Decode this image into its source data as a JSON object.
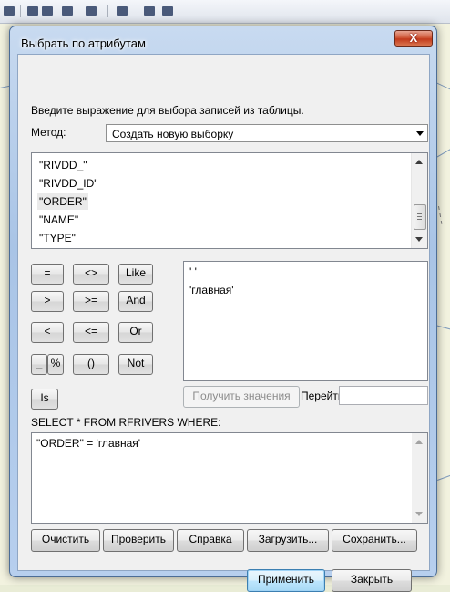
{
  "dialog": {
    "title": "Выбрать по атрибутам",
    "close_label": "X",
    "instruction": "Введите выражение для выбора записей из таблицы.",
    "method_label": "Метод:",
    "method_value": "Создать новую выборку",
    "fields": [
      "\"RIVDD_\"",
      "\"RIVDD_ID\"",
      "\"ORDER\"",
      "\"NAME\"",
      "\"TYPE\""
    ],
    "operators": {
      "eq": "=",
      "ne": "<>",
      "like": "Like",
      "gt": ">",
      "ge": ">=",
      "and": "And",
      "lt": "<",
      "le": "<=",
      "or": "Or",
      "underscore": "_",
      "percent": "%",
      "parens": "()",
      "not": "Not",
      "is": "Is"
    },
    "values": [
      "' '",
      "'главная'"
    ],
    "get_values_label": "Получить значения",
    "goto_label": "Перейти:",
    "goto_value": "",
    "sql_prefix": "SELECT * FROM RFRIVERS WHERE:",
    "expression": "\"ORDER\" = 'главная'",
    "buttons": {
      "clear": "Очистить",
      "verify": "Проверить",
      "help": "Справка",
      "load": "Загрузить...",
      "save": "Сохранить...",
      "apply": "Применить",
      "close": "Закрыть"
    }
  }
}
